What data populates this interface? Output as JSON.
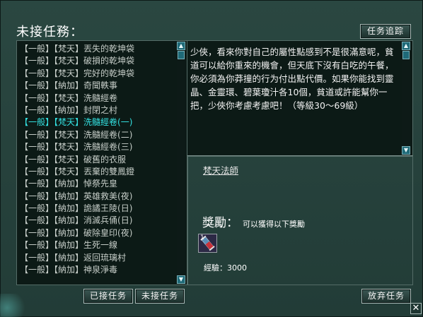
{
  "window": {
    "title": "未接任務："
  },
  "buttons": {
    "track": "任务追踪",
    "accepted": "已接任务",
    "unaccepted": "未接任务",
    "abandon": "放弃任务"
  },
  "tasks": [
    {
      "cat": "【一般】",
      "sub": "【梵天】",
      "name": "丟失的乾坤袋"
    },
    {
      "cat": "【一般】",
      "sub": "【梵天】",
      "name": "破損的乾坤袋"
    },
    {
      "cat": "【一般】",
      "sub": "【梵天】",
      "name": "完好的乾坤袋"
    },
    {
      "cat": "【一般】",
      "sub": "【納加】",
      "name": "奇聞軼事"
    },
    {
      "cat": "【一般】",
      "sub": "【梵天】",
      "name": "洗髓經卷"
    },
    {
      "cat": "【一般】",
      "sub": "【納加】",
      "name": "封閉之村"
    },
    {
      "cat": "【一般】",
      "sub": "【梵天】",
      "name": "洗髓經卷(一)"
    },
    {
      "cat": "【一般】",
      "sub": "【梵天】",
      "name": "洗髓經卷(二)"
    },
    {
      "cat": "【一般】",
      "sub": "【梵天】",
      "name": "洗髓經卷(三)"
    },
    {
      "cat": "【一般】",
      "sub": "【梵天】",
      "name": "破舊的衣服"
    },
    {
      "cat": "【一般】",
      "sub": "【梵天】",
      "name": "丟棄的雙鳳鐙"
    },
    {
      "cat": "【一般】",
      "sub": "【納加】",
      "name": "悼祭先皇"
    },
    {
      "cat": "【一般】",
      "sub": "【納加】",
      "name": "英雄救美(夜)"
    },
    {
      "cat": "【一般】",
      "sub": "【納加】",
      "name": "詭譎王陵(日)"
    },
    {
      "cat": "【一般】",
      "sub": "【納加】",
      "name": "消滅兵俑(日)"
    },
    {
      "cat": "【一般】",
      "sub": "【納加】",
      "name": "破除皇印(夜)"
    },
    {
      "cat": "【一般】",
      "sub": "【納加】",
      "name": "生死一線"
    },
    {
      "cat": "【一般】",
      "sub": "【納加】",
      "name": "返回琉璃村"
    },
    {
      "cat": "【一般】",
      "sub": "【納加】",
      "name": "神泉淨毒"
    }
  ],
  "selected_index": 6,
  "description": "少俠，看來你對自己的屬性點感到不是很滿意呢，貧道可以給你重來的機會，但天底下沒有白吃的午餐，你必須為你莽撞的行为付出點代價。如果你能找到靈晶、金靈環、碧葉瓊汁各10個，貧道或許能幫你一把，少俠你考慮考慮吧！（等級30～69級）",
  "npc": "梵天法師",
  "reward": {
    "title": "獎勵",
    "colon": "：",
    "subtitle": "可以獲得以下獎勵",
    "item_count": "1",
    "exp_label": "經驗：3000"
  },
  "icons": {
    "close": "close-icon",
    "scroll_up": "triangle-up-icon",
    "scroll_down": "triangle-down-icon",
    "item": "scroll-item-icon"
  },
  "colors": {
    "selected_task": "#33e1e1",
    "panel_bg": "#0c1a16",
    "frame_bg": "#223c37"
  }
}
